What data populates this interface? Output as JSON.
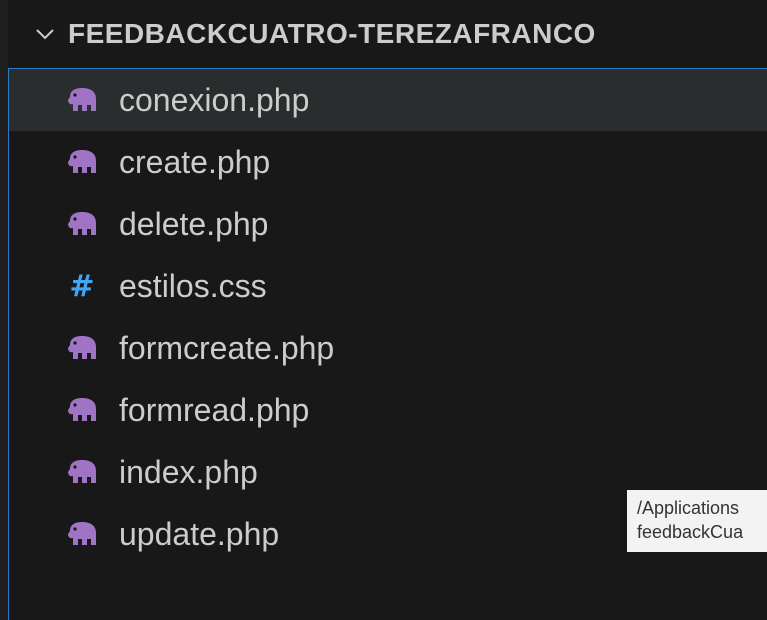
{
  "explorer": {
    "folder_name": "FEEDBACKCUATRO-TEREZAFRANCO",
    "files": [
      {
        "name": "conexion.php",
        "icon": "php-elephant-icon",
        "selected": true
      },
      {
        "name": "create.php",
        "icon": "php-elephant-icon",
        "selected": false
      },
      {
        "name": "delete.php",
        "icon": "php-elephant-icon",
        "selected": false
      },
      {
        "name": "estilos.css",
        "icon": "css-hash-icon",
        "selected": false
      },
      {
        "name": "formcreate.php",
        "icon": "php-elephant-icon",
        "selected": false
      },
      {
        "name": "formread.php",
        "icon": "php-elephant-icon",
        "selected": false
      },
      {
        "name": "index.php",
        "icon": "php-elephant-icon",
        "selected": false
      },
      {
        "name": "update.php",
        "icon": "php-elephant-icon",
        "selected": false
      }
    ]
  },
  "tooltip": {
    "line1": "/Applications",
    "line2": "feedbackCua"
  },
  "colors": {
    "background": "#181818",
    "selected_row": "#2a2d2e",
    "php_icon": "#a074c4",
    "css_icon": "#42a5f5",
    "focus_border": "#2b79c2"
  }
}
